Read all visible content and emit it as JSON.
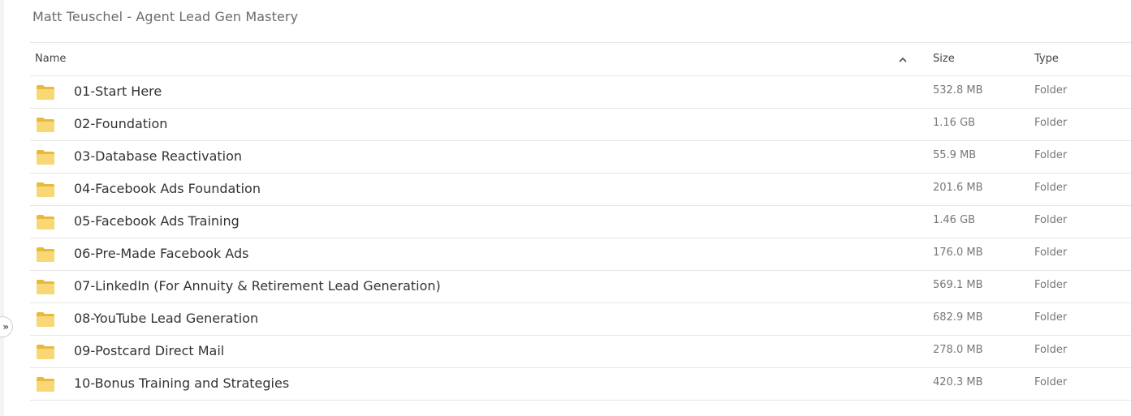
{
  "breadcrumb": {
    "title": "Matt Teuschel - Agent Lead Gen Mastery"
  },
  "table": {
    "headers": {
      "name": "Name",
      "size": "Size",
      "type": "Type"
    },
    "sort": {
      "column": "name",
      "direction": "ascending",
      "icon": "chevron-up-icon"
    },
    "rows": [
      {
        "name": "01-Start Here",
        "size": "532.8 MB",
        "type": "Folder"
      },
      {
        "name": "02-Foundation",
        "size": "1.16 GB",
        "type": "Folder"
      },
      {
        "name": "03-Database Reactivation",
        "size": "55.9 MB",
        "type": "Folder"
      },
      {
        "name": "04-Facebook Ads Foundation",
        "size": "201.6 MB",
        "type": "Folder"
      },
      {
        "name": "05-Facebook Ads Training",
        "size": "1.46 GB",
        "type": "Folder"
      },
      {
        "name": "06-Pre-Made Facebook Ads",
        "size": "176.0 MB",
        "type": "Folder"
      },
      {
        "name": "07-LinkedIn (For Annuity & Retirement Lead Generation)",
        "size": "569.1 MB",
        "type": "Folder"
      },
      {
        "name": "08-YouTube Lead Generation",
        "size": "682.9 MB",
        "type": "Folder"
      },
      {
        "name": "09-Postcard Direct Mail",
        "size": "278.0 MB",
        "type": "Folder"
      },
      {
        "name": "10-Bonus Training and Strategies",
        "size": "420.3 MB",
        "type": "Folder"
      }
    ]
  },
  "sidebar_toggle": {
    "label": "»",
    "icon": "double-chevron-right-icon"
  },
  "colors": {
    "folder": "#F8D775",
    "folder_dark": "#E8B93A",
    "divider": "#E6E6E6"
  }
}
